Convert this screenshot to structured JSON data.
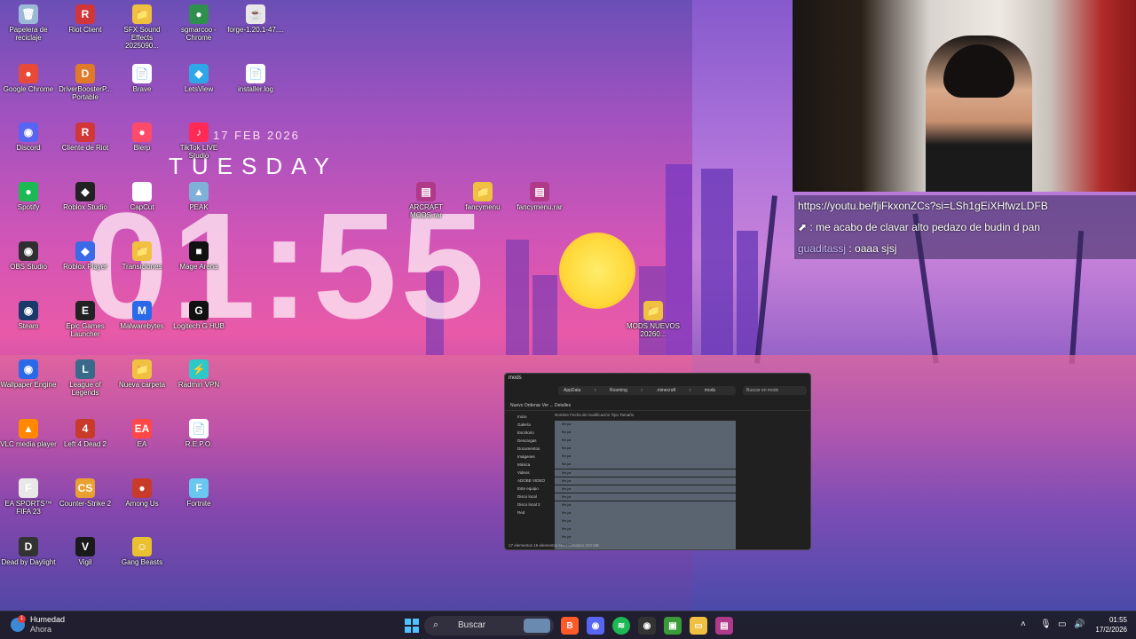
{
  "desktop_icons": [
    {
      "label": "Papelera de reciclaje",
      "glyph": "🗑",
      "color": "#9bb8d6"
    },
    {
      "label": "Riot Client",
      "glyph": "R",
      "color": "#d13639"
    },
    {
      "label": "SFX Sound Effects 2025090...",
      "glyph": "📁",
      "color": "#f0c040"
    },
    {
      "label": "sgmarcoo - Chrome",
      "glyph": "●",
      "color": "#2f8f4f"
    },
    {
      "label": "forge-1.20.1-47....",
      "glyph": "☕",
      "color": "#e8e8e8"
    },
    {
      "label": "Google Chrome",
      "glyph": "●",
      "color": "#e84a3a"
    },
    {
      "label": "DriverBoosterP... Portable",
      "glyph": "D",
      "color": "#e07a2a"
    },
    {
      "label": "Brave",
      "glyph": "📄",
      "color": "#ffffff"
    },
    {
      "label": "LetsView",
      "glyph": "◆",
      "color": "#2fa6e8"
    },
    {
      "label": "installer.log",
      "glyph": "📄",
      "color": "#ffffff"
    },
    {
      "label": "Discord",
      "glyph": "◉",
      "color": "#5865f2"
    },
    {
      "label": "Cliente de Riot",
      "glyph": "R",
      "color": "#d13639"
    },
    {
      "label": "Blerp",
      "glyph": "●",
      "color": "#ff4a6a"
    },
    {
      "label": "TikTok LIVE Studio",
      "glyph": "♪",
      "color": "#ff2a55"
    },
    {
      "label": "Spotify",
      "glyph": "●",
      "color": "#1db954"
    },
    {
      "label": "Roblox Studio",
      "glyph": "◆",
      "color": "#222222"
    },
    {
      "label": "CapCut",
      "glyph": "✂",
      "color": "#ffffff"
    },
    {
      "label": "PEAK",
      "glyph": "▲",
      "color": "#7fb0d8"
    },
    {
      "label": "ARCRAFT MODS.rar",
      "glyph": "▤",
      "color": "#b03a8a"
    },
    {
      "label": "fancymenu",
      "glyph": "📁",
      "color": "#f0c040"
    },
    {
      "label": "fancymenu.rar",
      "glyph": "▤",
      "color": "#b03a8a"
    },
    {
      "label": "OBS Studio",
      "glyph": "◉",
      "color": "#302e31"
    },
    {
      "label": "Roblox Player",
      "glyph": "◆",
      "color": "#3a6ae8"
    },
    {
      "label": "Transiciones",
      "glyph": "📁",
      "color": "#f0c040"
    },
    {
      "label": "Mage Arena",
      "glyph": "■",
      "color": "#111111"
    },
    {
      "label": "Steam",
      "glyph": "◉",
      "color": "#1b3a6a"
    },
    {
      "label": "Epic Games Launcher",
      "glyph": "E",
      "color": "#222222"
    },
    {
      "label": "Malwarebytes",
      "glyph": "M",
      "color": "#2a6ae8"
    },
    {
      "label": "Logitech G HUB",
      "glyph": "G",
      "color": "#111111"
    },
    {
      "label": "MODS NUEVOS 20260...",
      "glyph": "📁",
      "color": "#f0c040"
    },
    {
      "label": "Wallpaper Engine",
      "glyph": "◉",
      "color": "#2a6ae8"
    },
    {
      "label": "League of Legends",
      "glyph": "L",
      "color": "#3a6a8a"
    },
    {
      "label": "Nueva carpeta",
      "glyph": "📁",
      "color": "#f0c040"
    },
    {
      "label": "Radmin VPN",
      "glyph": "⚡",
      "color": "#2fc8c8"
    },
    {
      "label": "VLC media player",
      "glyph": "▲",
      "color": "#ff8800"
    },
    {
      "label": "Left 4 Dead 2",
      "glyph": "4",
      "color": "#c83a2a"
    },
    {
      "label": "EA",
      "glyph": "EA",
      "color": "#ff4747"
    },
    {
      "label": "R.E.P.O.",
      "glyph": "📄",
      "color": "#ffffff"
    },
    {
      "label": "EA SPORTS™ FIFA 23",
      "glyph": "F",
      "color": "#e8e8e8"
    },
    {
      "label": "Counter-Strike 2",
      "glyph": "CS",
      "color": "#e8a030"
    },
    {
      "label": "Among Us",
      "glyph": "●",
      "color": "#c83a2a"
    },
    {
      "label": "Fortnite",
      "glyph": "F",
      "color": "#6ac8f0"
    },
    {
      "label": "Dead by Daylight",
      "glyph": "D",
      "color": "#333333"
    },
    {
      "label": "Vigil",
      "glyph": "V",
      "color": "#1a1a1a"
    },
    {
      "label": "Gang Beasts",
      "glyph": "☺",
      "color": "#e8c030"
    }
  ],
  "clock_widget": {
    "date": "17 FEB 2026",
    "day": "TUESDAY",
    "time": "01:55"
  },
  "explorer": {
    "title": "mods",
    "breadcrumb": "AppData › Roaming › .minecraft › mods",
    "search_placeholder": "Buscar en mods",
    "toolbar": "Nuevo   Ordenar   Ver   ...   Detalles",
    "columns": "Nombre        Fecha de modificación     Tipo        Tamaño",
    "sidebar": [
      "Inicio",
      "Galería",
      "Escritorio",
      "Descargas",
      "Documentos",
      "Imágenes",
      "Música",
      "Videos",
      "ADOBE VIDEO",
      "Este equipo",
      "Disco local",
      "Disco local 2",
      "Red"
    ],
    "files": [
      "file.jar",
      "file.jar",
      "file.jar",
      "file.jar",
      "file.jar",
      "file.jar",
      "file.jar",
      "file.jar",
      "file.jar",
      "file.jar",
      "file.jar",
      "file.jar",
      "file.jar",
      "file.jar",
      "file.jar",
      "file.jar"
    ],
    "status": "17 elementos   16 elementos seleccionados   223 MB"
  },
  "chat": {
    "link": "https://youtu.be/fjiFkxonZCs?si=LSh1gEiXHfwzLDFB",
    "msg1_user": "",
    "msg1_text": ": me acabo de clavar alto pedazo de budin d pan",
    "msg2_user": "guaditassj",
    "msg2_text": " : oaaa sjsj"
  },
  "taskbar": {
    "weather_title": "Humedad",
    "weather_sub": "Ahora",
    "search_placeholder": "Buscar",
    "time": "01:55",
    "date": "17/2/2026",
    "notification_badge": "1"
  }
}
